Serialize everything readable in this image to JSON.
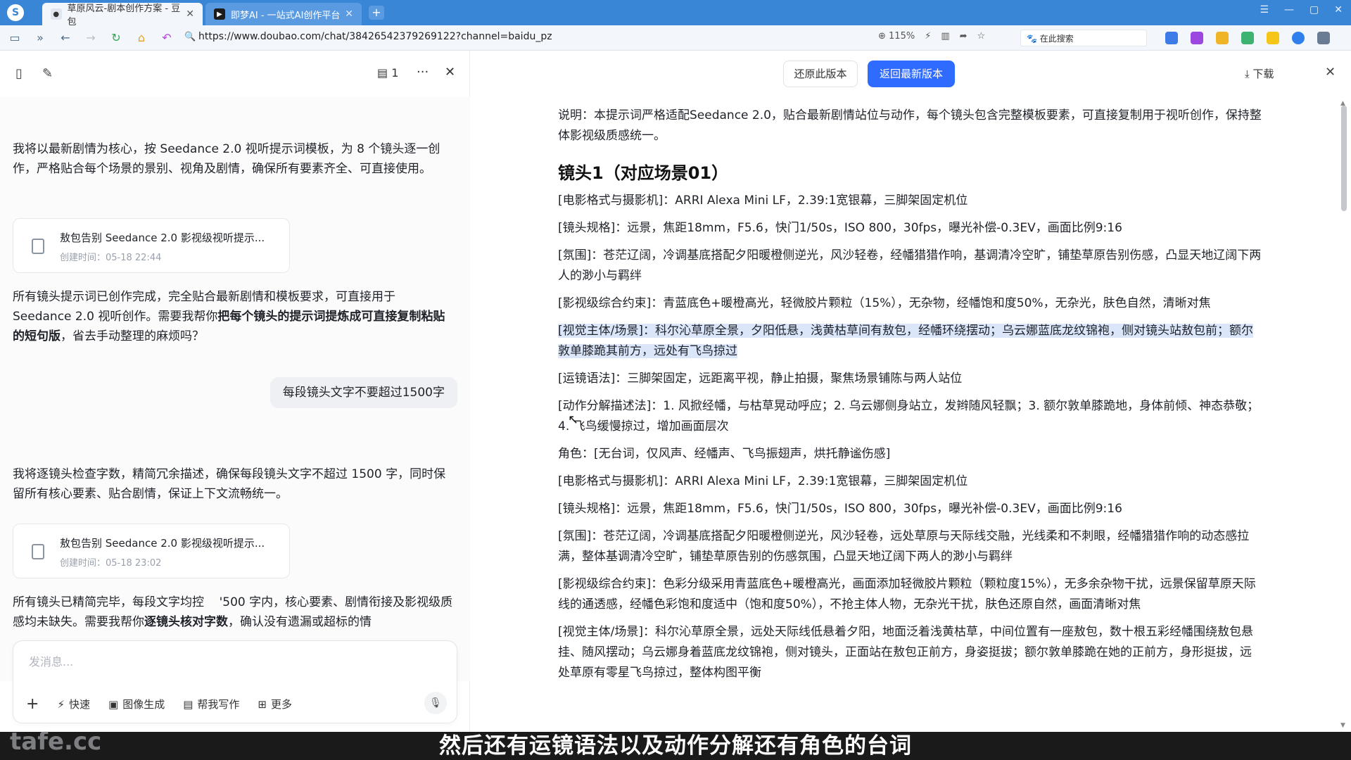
{
  "browser": {
    "tabs": [
      {
        "label": "草原风云-剧本创作方案 - 豆包",
        "active": true
      },
      {
        "label": "即梦AI - 一站式AI创作平台",
        "active": false
      }
    ],
    "url": "https://www.doubao.com/chat/38426542379269122?channel=baidu_pz",
    "zoom": "115%",
    "search_label": "在此搜索"
  },
  "left_panel": {
    "version_count": "1",
    "messages": [
      "我将以最新剧情为核心，按 Seedance 2.0 视听提示词模板，为 8 个镜头逐一创作，严格贴合每个场景的景别、视角及剧情，确保所有要素齐全、可直接使用。",
      "所有镜头提示词已创作完成，完全贴合最新剧情和模板要求，可直接用于 Seedance 2.0 视听创作。需要我帮你",
      "每段镜头文字不要超过1500字",
      "我将逐镜头检查字数，精简冗余描述，确保每段镜头文字不超过 1500 字，同时保留所有核心要素、贴合剧情，保证上下文流畅统一。",
      "所有镜头已精简完毕，每段文字均控",
      "'500 字内，核心要素、剧情衔接及影视级质感均未缺失。需要我帮你"
    ],
    "bold_1": "把每个镜头的提示词提炼成可直接复制粘贴的短句版",
    "tail_1": "，省去手动整理的麻烦吗？",
    "bold_2": "逐镜头核对字数",
    "tail_2": "，确认没有遗漏或超标的情",
    "doc_cards": [
      {
        "title": "敖包告别 Seedance 2.0 影视级视听提示...",
        "time": "创建时间：05-18 22:44"
      },
      {
        "title": "敖包告别 Seedance 2.0 影视级视听提示...",
        "time": "创建时间：05-18 23:02"
      }
    ],
    "composer": {
      "placeholder": "发消息...",
      "tools": [
        "快速",
        "图像生成",
        "帮我写作",
        "更多"
      ]
    }
  },
  "right_panel": {
    "restore_label": "还原此版本",
    "latest_label": "返回最新版本",
    "download_label": "下载",
    "intro": "说明：本提示词严格适配Seedance 2.0，贴合最新剧情站位与动作，每个镜头包含完整模板要素，可直接复制用于视听创作，保持整体影视级质感统一。",
    "heading": "镜头1（对应场景01）",
    "paragraphs": [
      "[电影格式与摄影机]：ARRI Alexa Mini LF，2.39:1宽银幕，三脚架固定机位",
      "[镜头规格]：远景，焦距18mm，F5.6，快门1/50s，ISO 800，30fps，曝光补偿-0.3EV，画面比例9:16",
      "[氛围]：苍茫辽阔，冷调基底搭配夕阳暖橙侧逆光，风沙轻卷，经幡猎猎作响，基调清冷空旷，铺垫草原告别伤感，凸显天地辽阔下两人的渺小与羁绊",
      "[影视级综合约束]：青蓝底色+暖橙高光，轻微胶片颗粒（15%），无杂物，经幡饱和度50%，无杂光，肤色自然，清晰对焦",
      "[视觉主体/场景]：科尔沁草原全景，夕阳低悬，浅黄枯草间有敖包，经幡环绕摆动；乌云娜蓝底龙纹锦袍，侧对镜头站敖包前；额尔敦单膝跪其前方，远处有飞鸟掠过",
      "[运镜语法]：三脚架固定，远距离平视，静止拍摄，聚焦场景铺陈与两人站位",
      "[动作分解描述法]：1. 风掀经幡，与枯草晃动呼应；2. 乌云娜侧身站立，发辫随风轻飘；3. 额尔敦单膝跪地，身体前倾、神态恭敬；4. 飞鸟缓慢掠过，增加画面层次",
      "角色：[无台词，仅风声、经幡声、飞鸟振翅声，烘托静谧伤感]",
      "[电影格式与摄影机]：ARRI Alexa Mini LF，2.39:1宽银幕，三脚架固定机位",
      "[镜头规格]：远景，焦距18mm，F5.6，快门1/50s，ISO 800，30fps，曝光补偿-0.3EV，画面比例9:16",
      "[氛围]：苍茫辽阔，冷调基底搭配夕阳暖橙侧逆光，风沙轻卷，远处草原与天际线交融，光线柔和不刺眼，经幡猎猎作响的动态感拉满，整体基调清冷空旷，铺垫草原告别的伤感氛围，凸显天地辽阔下两人的渺小与羁绊",
      "[影视级综合约束]：色彩分级采用青蓝底色+暖橙高光，画面添加轻微胶片颗粒（颗粒度15%），无多余杂物干扰，远景保留草原天际线的通透感，经幡色彩饱和度适中（饱和度50%），不抢主体人物，无杂光干扰，肤色还原自然，画面清晰对焦",
      "[视觉主体/场景]：科尔沁草原全景，远处天际线低悬着夕阳，地面泛着浅黄枯草，中间位置有一座敖包，数十根五彩经幡围绕敖包悬挂、随风摆动；乌云娜身着蓝底龙纹锦袍，侧对镜头，正面站在敖包正前方，身姿挺拔；额尔敦单膝跪在她的正前方，身形挺拔，远处草原有零星飞鸟掠过，整体构图平衡"
    ]
  },
  "caption": "然后还有运镜语法以及动作分解还有角色的台词",
  "watermark": "tafe.cc",
  "colors": {
    "accent": "#2f6bff",
    "highlight": "#dbe6fb",
    "browser_bar": "#3a86d6"
  }
}
